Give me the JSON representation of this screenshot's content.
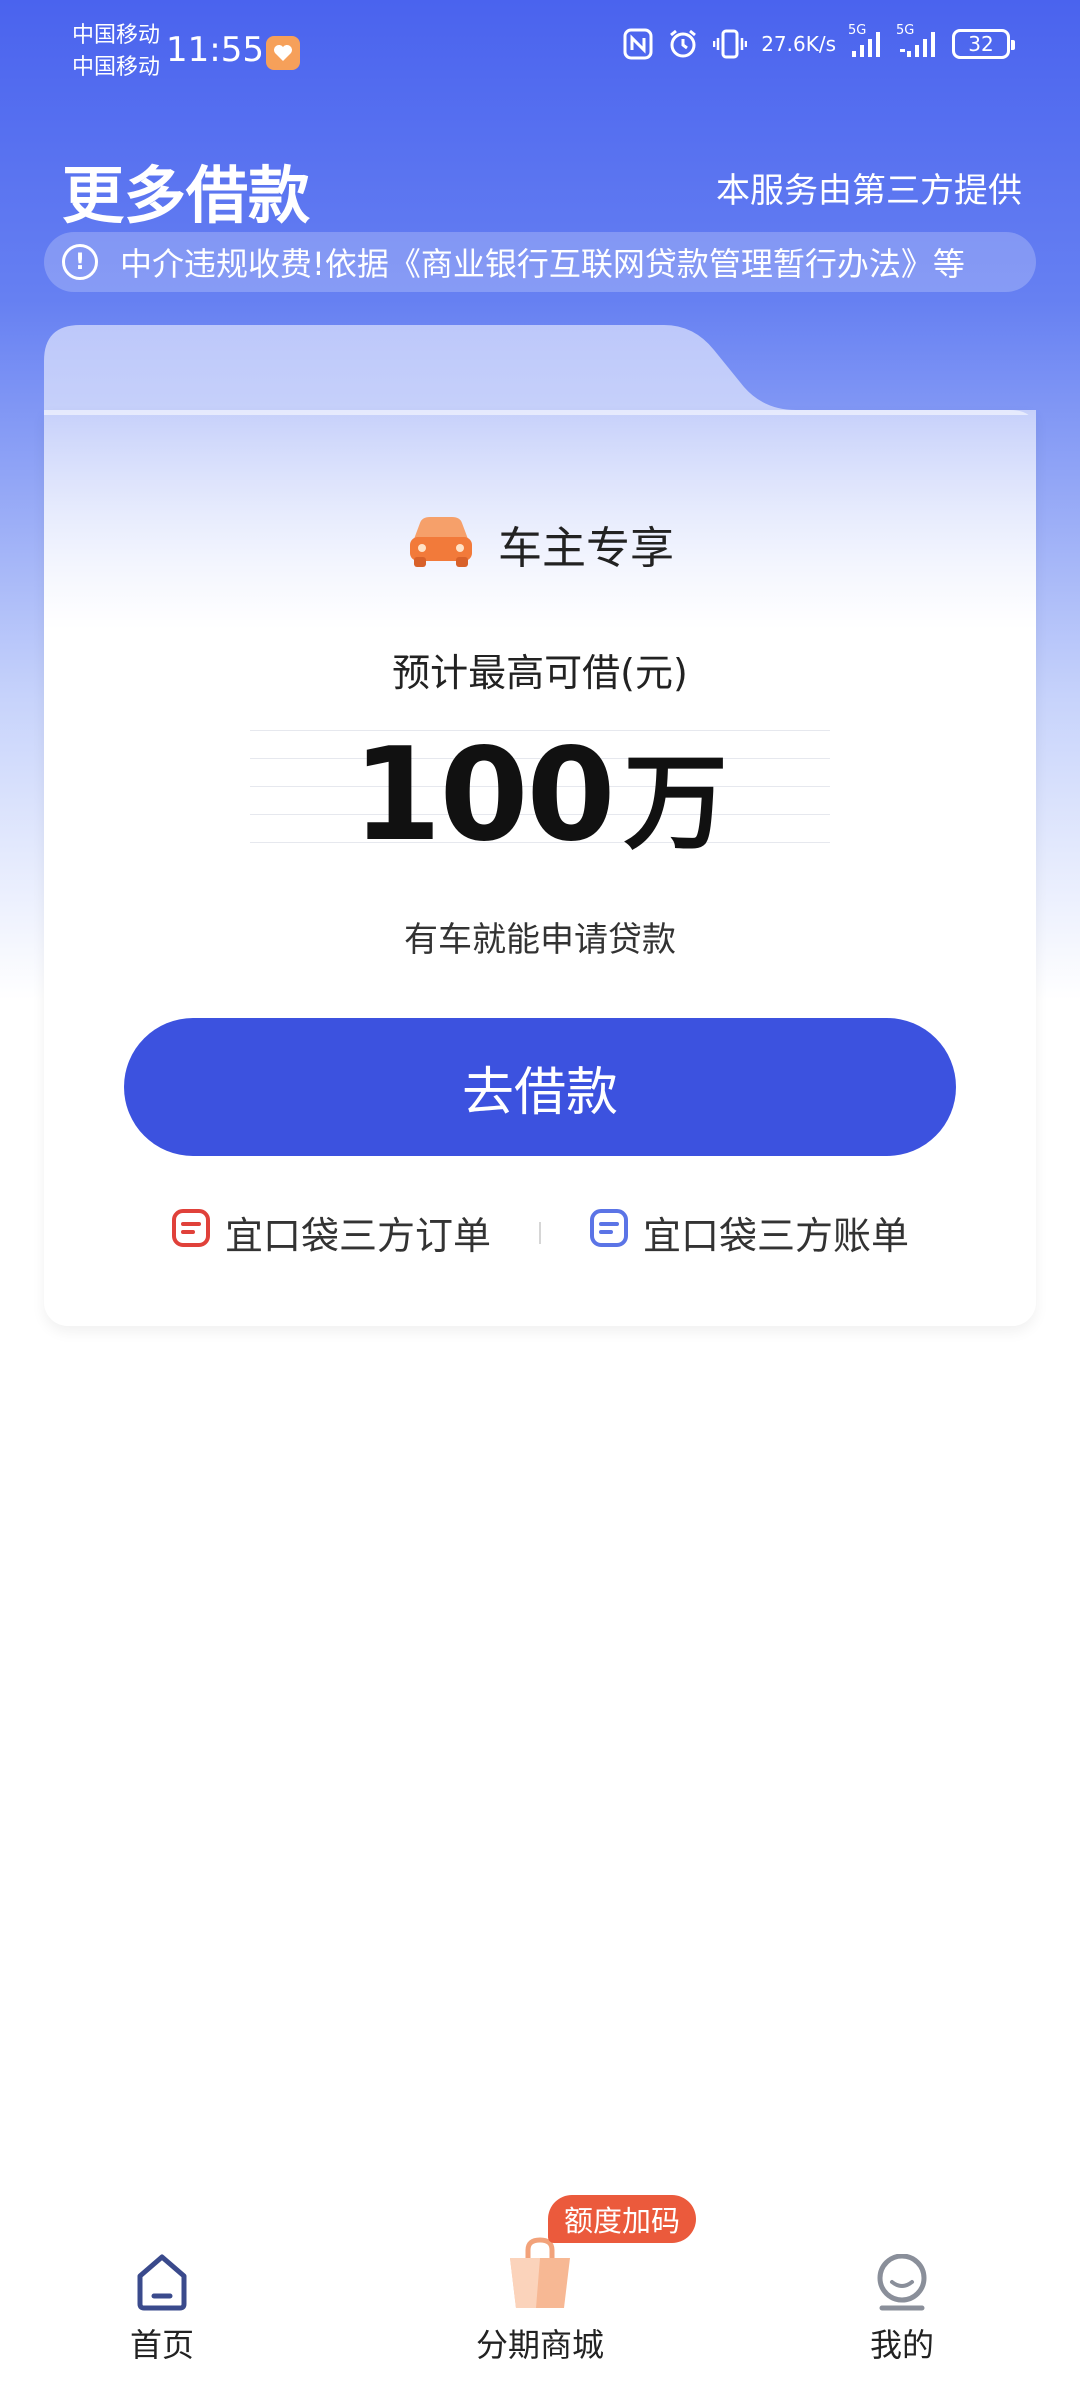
{
  "status_bar": {
    "carrier_1": "中国移动",
    "carrier_2": "中国移动",
    "time": "11:55",
    "network_speed_value": "27.6",
    "network_speed_unit": "K/s",
    "signal_label_1": "5G",
    "signal_label_2": "5G",
    "battery": "32"
  },
  "header": {
    "title": "更多借款",
    "provider_note": "本服务由第三方提供"
  },
  "notice": {
    "text": "中介违规收费!依据《商业银行互联网贷款管理暂行办法》等"
  },
  "card": {
    "badge_label": "车主专享",
    "amount_label": "预计最高可借(元)",
    "amount_value": "100",
    "amount_unit": "万",
    "hint": "有车就能申请贷款",
    "cta_label": "去借款",
    "link_orders": "宜口袋三方订单",
    "link_bills": "宜口袋三方账单"
  },
  "bottom_nav": {
    "home": "首页",
    "mall": "分期商城",
    "mine": "我的",
    "promo_badge": "额度加码"
  },
  "colors": {
    "primary": "#3c52df",
    "car_icon": "#f27a3a",
    "orders_icon": "#e0413a",
    "bills_icon": "#5b74e6",
    "promo": "#eb5a3c"
  }
}
